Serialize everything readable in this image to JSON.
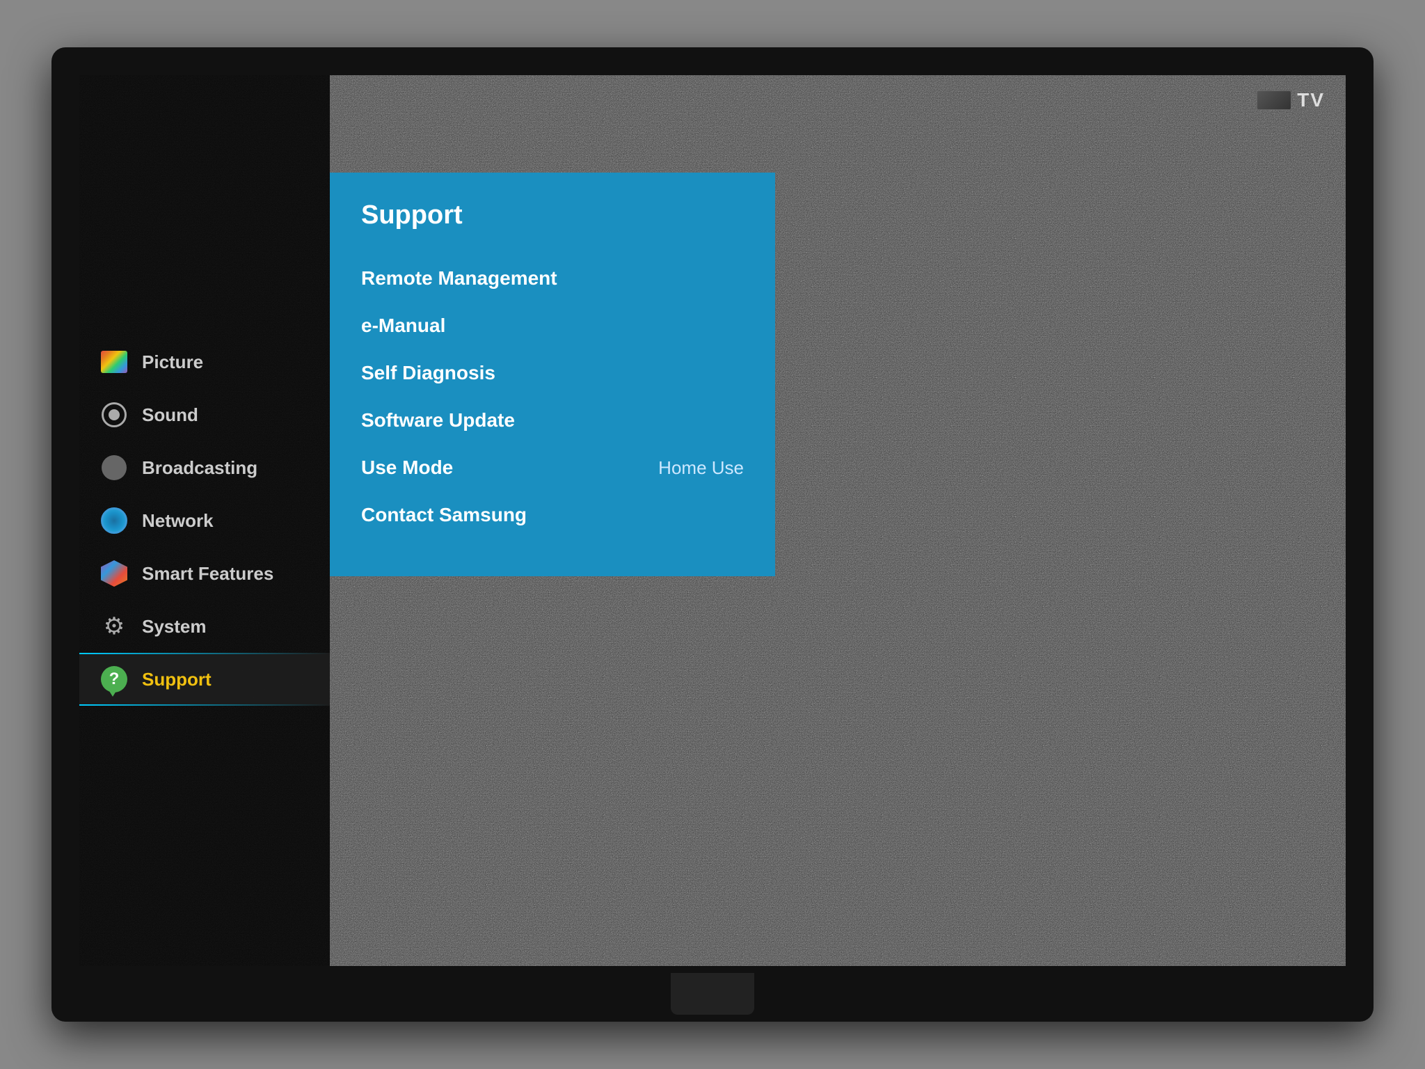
{
  "tv": {
    "label": "TV"
  },
  "sidebar": {
    "items": [
      {
        "id": "picture",
        "label": "Picture",
        "icon": "picture-icon",
        "active": false
      },
      {
        "id": "sound",
        "label": "Sound",
        "icon": "sound-icon",
        "active": false
      },
      {
        "id": "broadcasting",
        "label": "Broadcasting",
        "icon": "broadcasting-icon",
        "active": false
      },
      {
        "id": "network",
        "label": "Network",
        "icon": "network-icon",
        "active": false
      },
      {
        "id": "smart-features",
        "label": "Smart Features",
        "icon": "smart-features-icon",
        "active": false
      },
      {
        "id": "system",
        "label": "System",
        "icon": "system-icon",
        "active": false
      },
      {
        "id": "support",
        "label": "Support",
        "icon": "support-icon",
        "active": true
      }
    ]
  },
  "support_panel": {
    "title": "Support",
    "menu_items": [
      {
        "id": "remote-management",
        "label": "Remote Management",
        "value": ""
      },
      {
        "id": "e-manual",
        "label": "e-Manual",
        "value": ""
      },
      {
        "id": "self-diagnosis",
        "label": "Self Diagnosis",
        "value": ""
      },
      {
        "id": "software-update",
        "label": "Software Update",
        "value": ""
      },
      {
        "id": "use-mode",
        "label": "Use Mode",
        "value": "Home Use"
      },
      {
        "id": "contact-samsung",
        "label": "Contact Samsung",
        "value": ""
      }
    ]
  }
}
